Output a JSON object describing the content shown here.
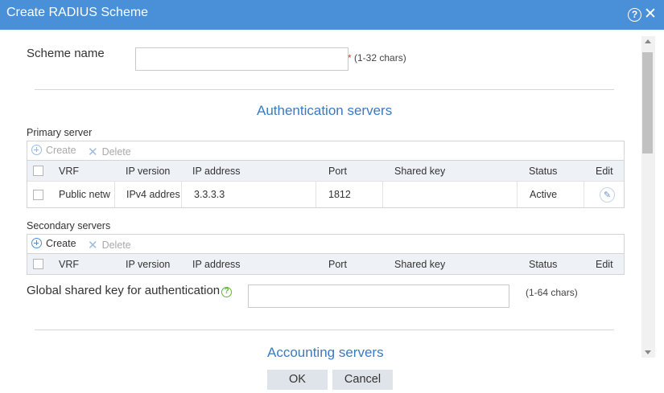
{
  "dialog": {
    "title": "Create RADIUS Scheme",
    "help_glyph": "?",
    "close_glyph": "✕"
  },
  "scheme": {
    "label": "Scheme name",
    "value": "",
    "required_mark": "*",
    "hint": "(1-32 chars)"
  },
  "auth": {
    "title": "Authentication servers",
    "primary": {
      "label": "Primary server",
      "toolbar": {
        "create": "Create",
        "delete": "Delete"
      },
      "columns": [
        "VRF",
        "IP version",
        "IP address",
        "Port",
        "Shared key",
        "Status",
        "Edit"
      ],
      "rows": [
        {
          "vrf": "Public netw",
          "ip_version": "IPv4 addres",
          "ip_address": "3.3.3.3",
          "port": "1812",
          "shared_key": "",
          "status": "Active",
          "edit_icon": "pencil-icon"
        }
      ]
    },
    "secondary": {
      "label": "Secondary servers",
      "toolbar": {
        "create": "Create",
        "delete": "Delete"
      },
      "columns": [
        "VRF",
        "IP version",
        "IP address",
        "Port",
        "Shared key",
        "Status",
        "Edit"
      ]
    },
    "global_key": {
      "label": "Global shared key for authentication",
      "help_glyph": "?",
      "value": "",
      "hint": "(1-64 chars)"
    }
  },
  "acct": {
    "title": "Accounting servers"
  },
  "buttons": {
    "ok": "OK",
    "cancel": "Cancel"
  },
  "colors": {
    "title_bar": "#4a90d9",
    "section_title": "#3a7ac2",
    "help_icon": "#5cb82a",
    "required": "#e53935",
    "header_bg": "#eef1f6"
  }
}
